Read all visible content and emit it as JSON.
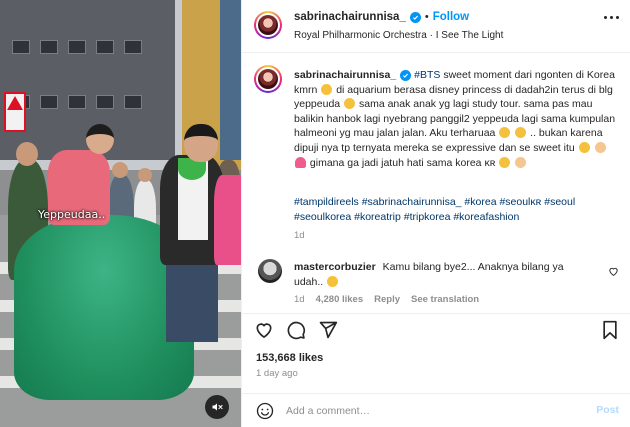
{
  "video": {
    "overlay_text": "Yeppeudaa..",
    "mute_icon": "speaker-muted-icon"
  },
  "header": {
    "username": "sabrinachairunnisa_",
    "separator": "•",
    "follow_label": "Follow",
    "music": "Royal Philharmonic Orchestra · I See The Light",
    "more_icon": "more-options-icon"
  },
  "caption": {
    "username": "sabrinachairunnisa_",
    "tag": "#BTS",
    "p1": "sweet moment dari ngonten di Korea kmrn",
    "p2": "di aquarium berasa disney princess di dadah2in terus di blg yeppeuda",
    "p3": "sama anak anak yg lagi study tour. sama pas mau balikin hanbok lagi nyebrang panggil2 yeppeuda lagi sama kumpulan halmeoni yg mau jalan jalan. Aku terharuaa",
    "p4": ".. bukan karena dipuji nya tp ternyata mereka se expressive dan se sweet itu",
    "p5": "gimana ga jadi jatuh hati sama korea",
    "p6": "ᴋʀ",
    "hashtags": "#tampildireels #sabrinachairunnisa_ #korea #seoulᴋʀ #seoul #seoulkorea #koreatrip #tripkorea #koreafashion",
    "time": "1d"
  },
  "comment": {
    "username": "mastercorbuzier",
    "text": "Kamu bilang bye2... Anaknya bilang ya udah..",
    "time": "1d",
    "likes": "4,280 likes",
    "reply": "Reply",
    "translation": "See translation"
  },
  "actions": {
    "likes": "153,668 likes",
    "time": "1 day ago"
  },
  "add_comment": {
    "placeholder": "Add a comment…",
    "post_label": "Post"
  },
  "colors": {
    "accent": "#0095f6",
    "hashtag": "#00376b",
    "muted": "#8e8e8e",
    "post_disabled": "#b3dbff"
  }
}
